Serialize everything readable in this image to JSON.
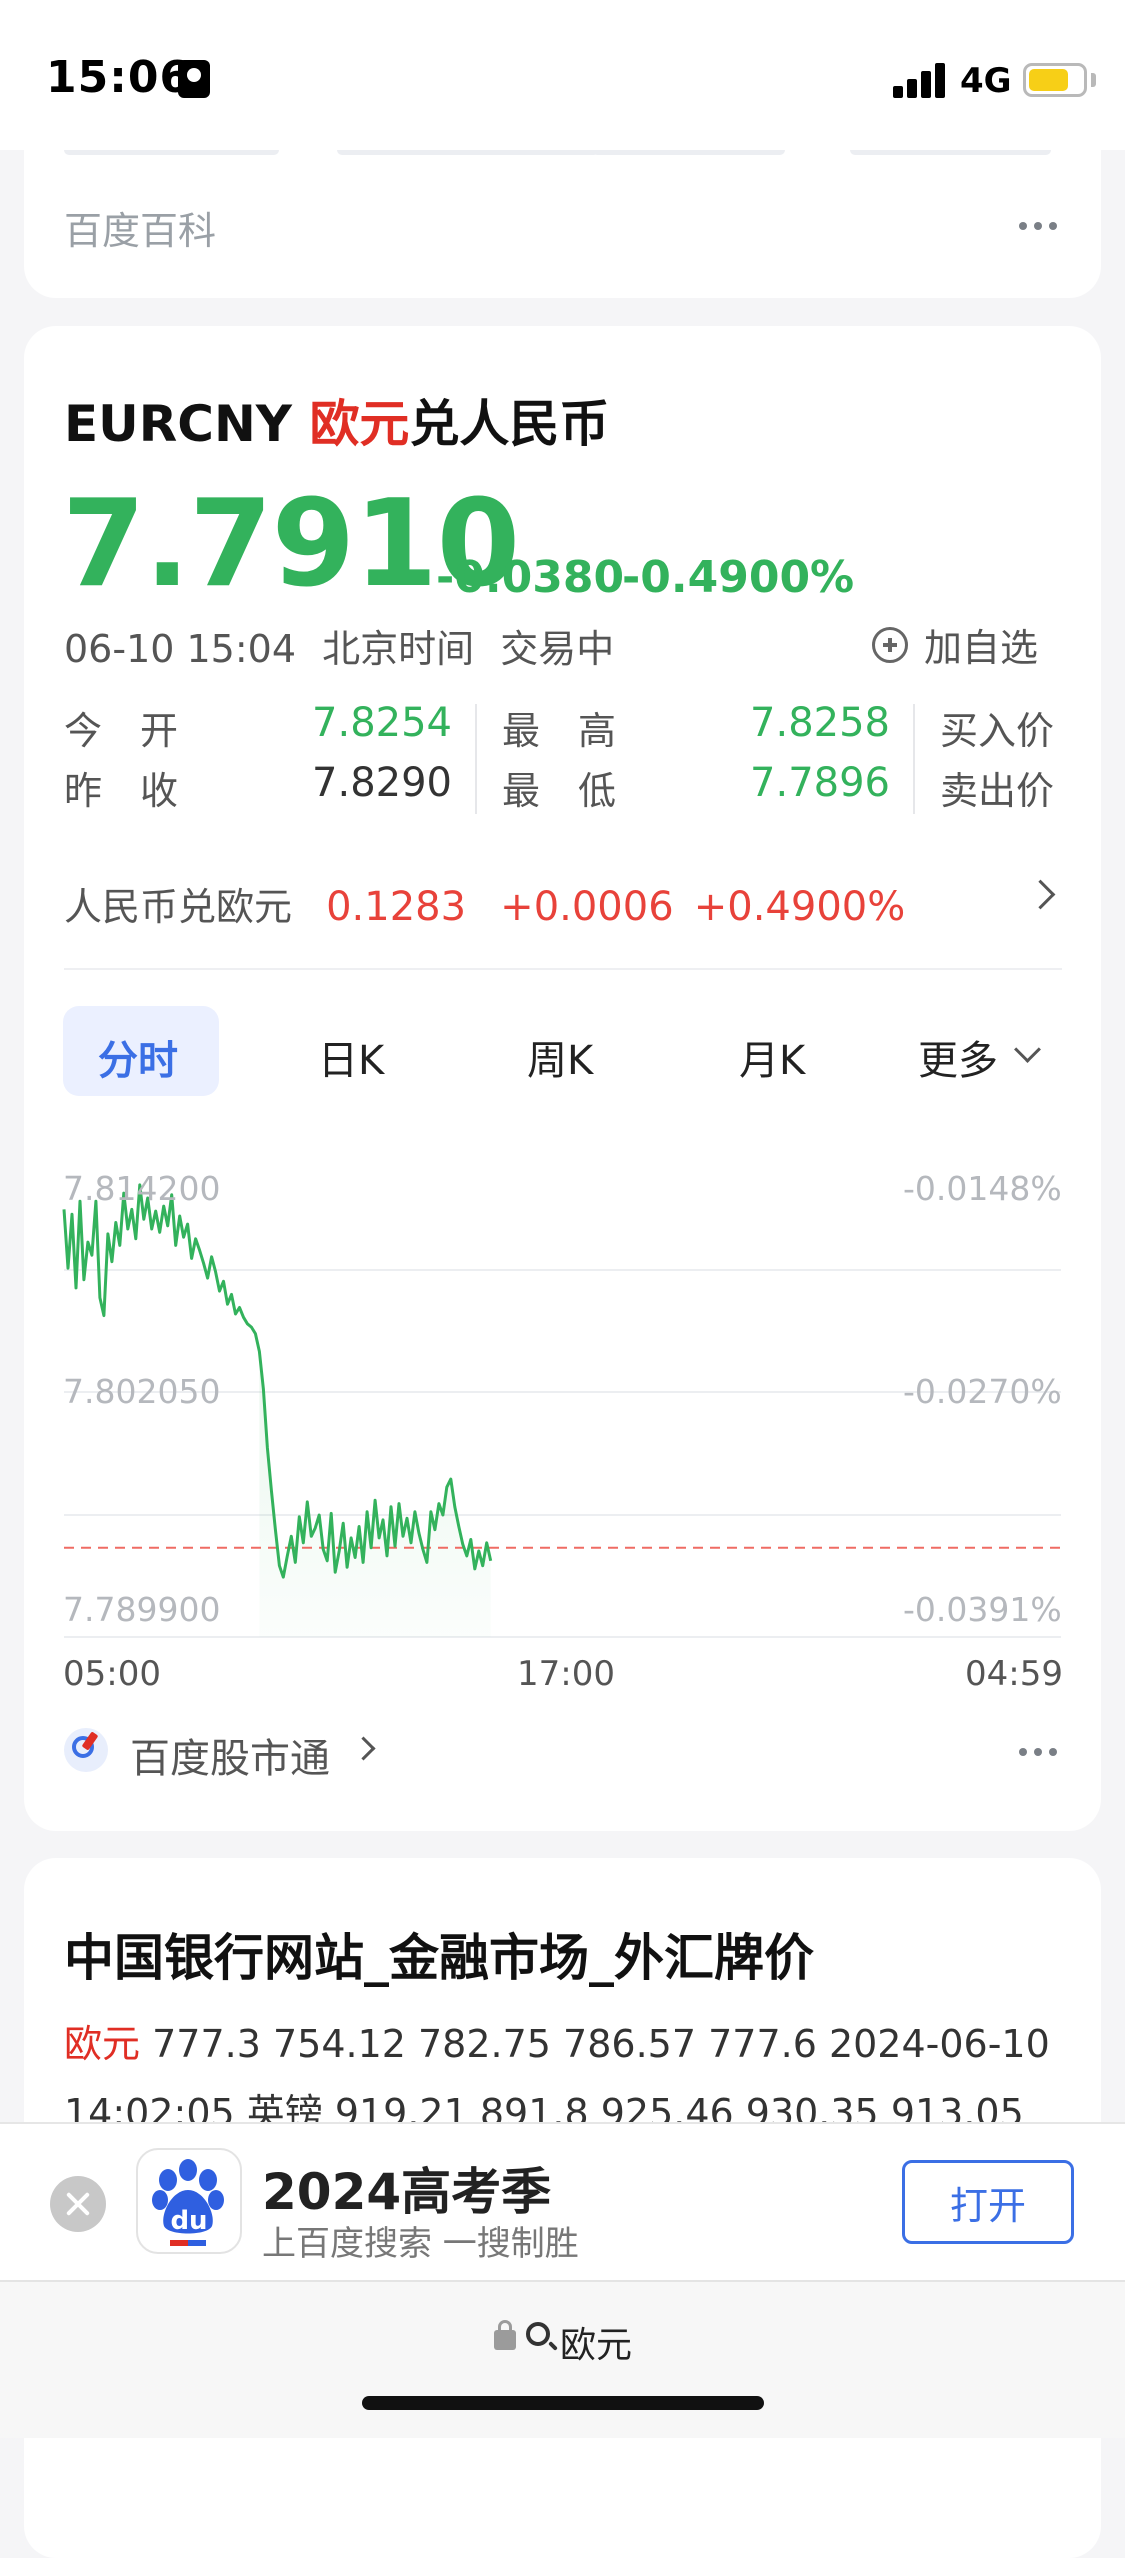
{
  "status_bar": {
    "time": "15:06",
    "network": "4G",
    "battery_level": 0.75,
    "icons": [
      "portrait-lock-icon",
      "signal-icon",
      "battery-icon"
    ]
  },
  "baike_card": {
    "title": "百度百科",
    "more_icon": "more-dots-icon"
  },
  "quote": {
    "symbol": "EURCNY",
    "base_name": "欧元",
    "quote_name": "兑人民币",
    "price": "7.7910",
    "change": "-0.0380",
    "change_pct": "-0.4900%",
    "timestamp": "06-10 15:04",
    "timezone": "北京时间",
    "status": "交易中",
    "add_watch_label": "加自选",
    "colors": {
      "down": "#33b25c",
      "up": "#e8423a",
      "accent": "#3b6fe5",
      "brand_red": "#e02e24"
    },
    "stats": {
      "open_label": "今　开",
      "open": "7.8254",
      "prev_close_label": "昨　收",
      "prev_close": "7.8290",
      "high_label": "最　高",
      "high": "7.8258",
      "low_label": "最　低",
      "low": "7.7896",
      "bid_label": "买入价",
      "ask_label": "卖出价"
    },
    "inverse": {
      "label": "人民币兑欧元",
      "price": "0.1283",
      "change": "+0.0006",
      "change_pct": "+0.4900%"
    },
    "tabs": [
      "分时",
      "日K",
      "周K",
      "月K",
      "更多"
    ],
    "active_tab": "分时",
    "source_label": "百度股市通"
  },
  "chart_data": {
    "type": "line",
    "y_tick_labels": [
      "7.814200",
      "7.802050",
      "7.789900"
    ],
    "y_right_tick_labels": [
      "-0.0148%",
      "-0.0270%",
      "-0.0391%"
    ],
    "x_tick_labels": [
      "05:00",
      "17:00",
      "04:59"
    ],
    "ylim": [
      7.7899,
      7.8142
    ],
    "reference_line": 7.7923,
    "grid": true,
    "x": [
      0,
      4,
      8,
      12,
      16,
      20,
      24,
      28,
      32,
      36,
      40,
      44,
      48,
      52,
      56,
      60,
      64,
      68,
      72,
      76,
      80,
      84,
      88,
      92,
      96,
      100,
      104,
      108,
      112,
      116,
      120,
      124,
      128,
      132,
      136,
      140,
      144,
      148,
      152,
      156,
      160,
      164,
      168,
      172,
      176,
      180,
      184,
      188,
      192,
      196,
      200,
      204,
      208,
      212,
      216,
      220,
      224,
      228,
      232,
      236,
      240,
      244,
      248,
      252,
      256,
      260,
      264,
      268,
      272,
      276,
      280,
      284,
      288,
      292,
      296,
      300,
      304,
      308,
      312,
      316,
      320,
      324,
      328,
      332,
      336,
      340,
      344,
      348,
      352,
      356,
      360,
      364,
      368,
      372,
      376,
      380,
      384,
      388,
      392,
      396,
      400,
      404,
      408,
      412,
      416,
      420,
      424,
      428
    ],
    "values": [
      7.813,
      7.8094,
      7.8127,
      7.8082,
      7.8135,
      7.8087,
      7.811,
      7.8102,
      7.8135,
      7.8076,
      7.8065,
      7.8115,
      7.8098,
      7.8122,
      7.8108,
      7.814,
      7.8118,
      7.813,
      7.8112,
      7.8145,
      7.8124,
      7.8137,
      7.8118,
      7.8129,
      7.8116,
      7.8132,
      7.812,
      7.8139,
      7.8108,
      7.8126,
      7.8113,
      7.8121,
      7.81,
      7.8112,
      7.8105,
      7.8097,
      7.8088,
      7.8101,
      7.8092,
      7.808,
      7.8086,
      7.8072,
      7.8078,
      7.8066,
      7.807,
      7.8064,
      7.806,
      7.8058,
      7.8054,
      7.8043,
      7.802,
      7.7984,
      7.7958,
      7.7934,
      7.7912,
      7.7905,
      7.7918,
      7.793,
      7.7914,
      7.7942,
      7.7926,
      7.7951,
      7.793,
      7.7935,
      7.7943,
      7.7922,
      7.7915,
      7.7944,
      7.7908,
      7.7921,
      7.7938,
      7.7911,
      7.7929,
      7.7917,
      7.7936,
      7.7914,
      7.7945,
      7.7923,
      7.7952,
      7.7929,
      7.794,
      7.7918,
      7.7948,
      7.7924,
      7.795,
      7.793,
      7.7941,
      7.7926,
      7.7945,
      7.7932,
      7.7922,
      7.7914,
      7.7945,
      7.7934,
      7.795,
      7.7943,
      7.796,
      7.7965,
      7.7948,
      7.7936,
      7.7925,
      7.7918,
      7.7928,
      7.791,
      7.7921,
      7.7912,
      7.7926,
      7.7915
    ],
    "x_range": [
      0,
      1000
    ]
  },
  "result_card": {
    "title": "中国银行网站_金融市场_外汇牌价",
    "snippet_highlight": "欧元",
    "snippet_line1": " 777.3 754.12 782.75 786.57 777.6 2024-06-10",
    "snippet_line2": "14:02:05 英镑 919.21 891.8 925.46 930.35 913.05"
  },
  "promo": {
    "title": "2024高考季",
    "subtitle": "上百度搜索 一搜制胜",
    "open_label": "打开",
    "app_logo_text": "du",
    "close_icon": "close-icon"
  },
  "address_bar": {
    "query": "欧元",
    "icons": [
      "lock-icon",
      "search-icon"
    ]
  }
}
